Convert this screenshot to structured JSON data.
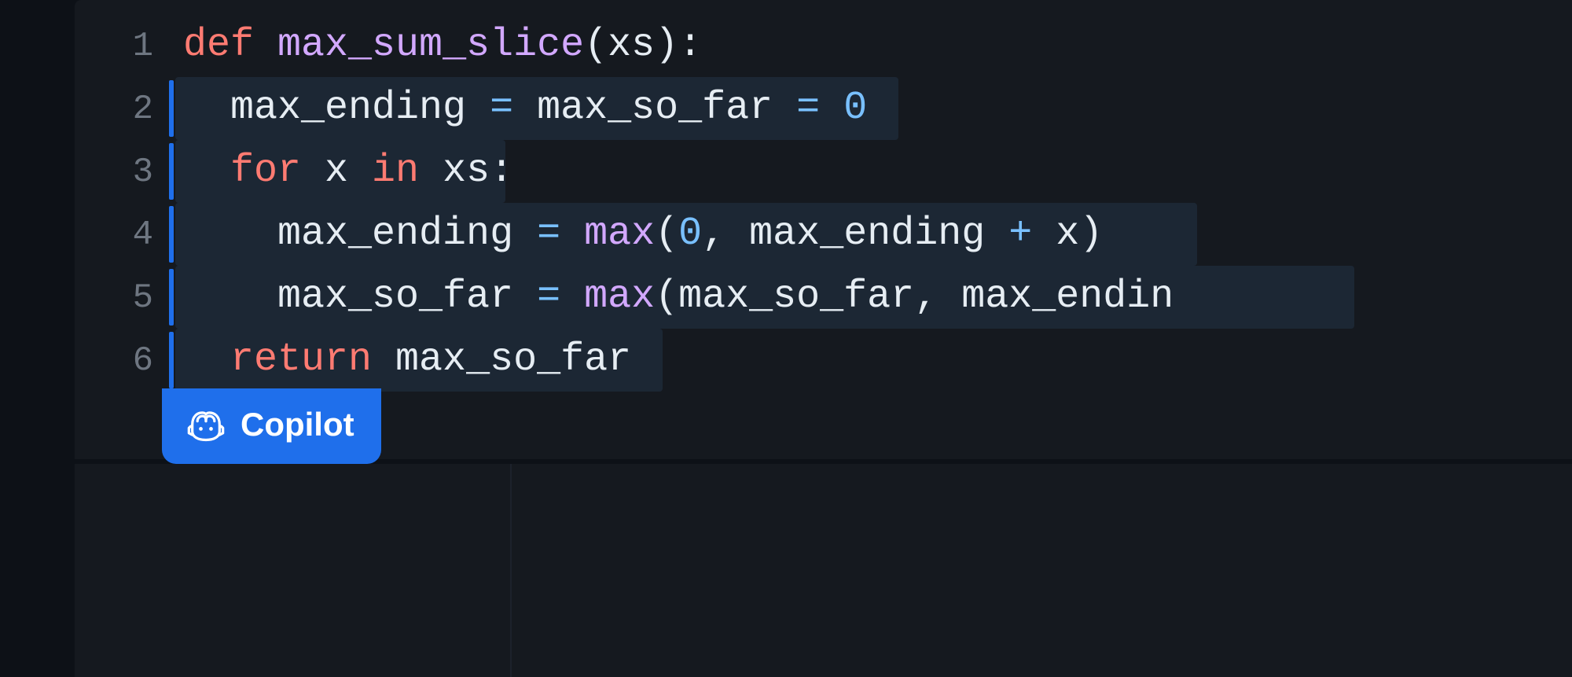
{
  "editor": {
    "lines": [
      {
        "num": "1",
        "suggested": false,
        "bg_width": 0,
        "tokens": [
          {
            "t": "def ",
            "c": "tk-kw"
          },
          {
            "t": "max_sum_slice",
            "c": "tk-fn"
          },
          {
            "t": "(",
            "c": "tk-pun"
          },
          {
            "t": "xs",
            "c": "tk-id"
          },
          {
            "t": "):",
            "c": "tk-pun"
          }
        ]
      },
      {
        "num": "2",
        "suggested": true,
        "bg_width": 920,
        "tokens": [
          {
            "t": "  max_ending ",
            "c": "tk-id"
          },
          {
            "t": "=",
            "c": "tk-op"
          },
          {
            "t": " max_so_far ",
            "c": "tk-id"
          },
          {
            "t": "=",
            "c": "tk-op"
          },
          {
            "t": " ",
            "c": "tk-id"
          },
          {
            "t": "0",
            "c": "tk-num"
          }
        ]
      },
      {
        "num": "3",
        "suggested": true,
        "bg_width": 420,
        "tokens": [
          {
            "t": "  ",
            "c": "tk-id"
          },
          {
            "t": "for",
            "c": "tk-kw"
          },
          {
            "t": " x ",
            "c": "tk-id"
          },
          {
            "t": "in",
            "c": "tk-kw"
          },
          {
            "t": " xs",
            "c": "tk-id"
          },
          {
            "t": ":",
            "c": "tk-pun"
          }
        ]
      },
      {
        "num": "4",
        "suggested": true,
        "bg_width": 1300,
        "tokens": [
          {
            "t": "    max_ending ",
            "c": "tk-id"
          },
          {
            "t": "=",
            "c": "tk-op"
          },
          {
            "t": " ",
            "c": "tk-id"
          },
          {
            "t": "max",
            "c": "tk-fn"
          },
          {
            "t": "(",
            "c": "tk-pun"
          },
          {
            "t": "0",
            "c": "tk-num"
          },
          {
            "t": ",",
            "c": "tk-pun"
          },
          {
            "t": " max_ending ",
            "c": "tk-id"
          },
          {
            "t": "+",
            "c": "tk-op"
          },
          {
            "t": " x",
            "c": "tk-id"
          },
          {
            "t": ")",
            "c": "tk-pun"
          }
        ]
      },
      {
        "num": "5",
        "suggested": true,
        "bg_width": 1500,
        "tokens": [
          {
            "t": "    max_so_far ",
            "c": "tk-id"
          },
          {
            "t": "=",
            "c": "tk-op"
          },
          {
            "t": " ",
            "c": "tk-id"
          },
          {
            "t": "max",
            "c": "tk-fn"
          },
          {
            "t": "(",
            "c": "tk-pun"
          },
          {
            "t": "max_so_far",
            "c": "tk-id"
          },
          {
            "t": ",",
            "c": "tk-pun"
          },
          {
            "t": " max_endin",
            "c": "tk-id"
          }
        ]
      },
      {
        "num": "6",
        "suggested": true,
        "bg_width": 620,
        "tokens": [
          {
            "t": "  ",
            "c": "tk-id"
          },
          {
            "t": "return",
            "c": "tk-kw"
          },
          {
            "t": " max_so_far",
            "c": "tk-id"
          }
        ]
      }
    ]
  },
  "copilot": {
    "label": "Copilot"
  },
  "colors": {
    "bg": "#0d1117",
    "panel": "#15191f",
    "suggestion": "#1c2734",
    "accent": "#1f6feb",
    "keyword": "#ff7b72",
    "function": "#d2a8ff",
    "identifier": "#e6edf3",
    "number_op": "#79c0ff",
    "gutter": "#6e7681"
  }
}
